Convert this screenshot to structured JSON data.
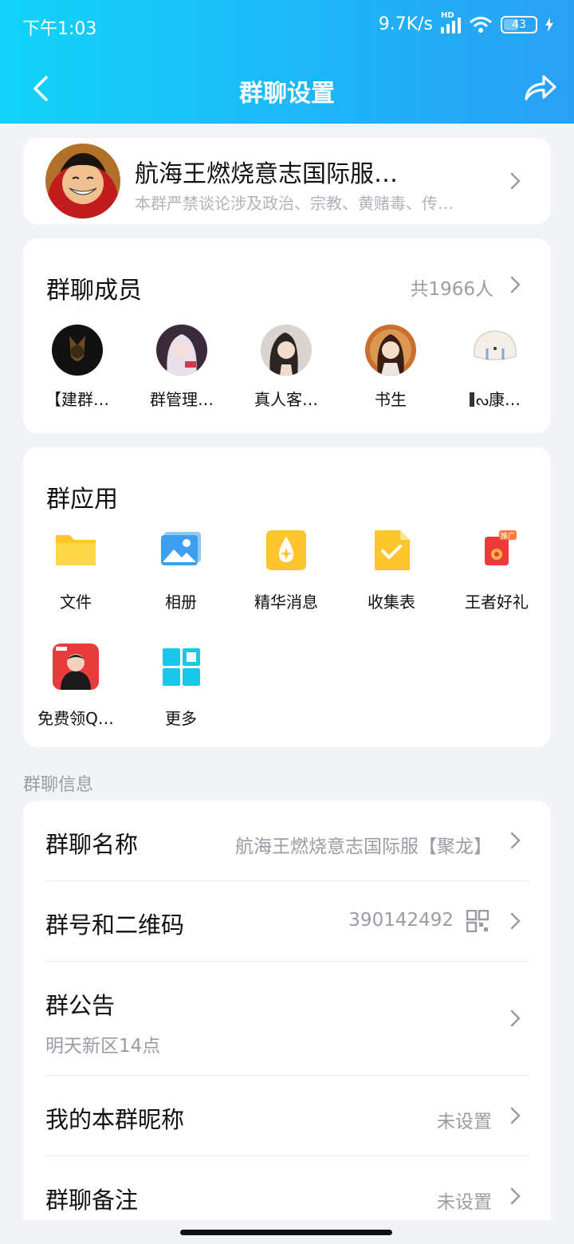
{
  "status_bar": {
    "time": "下午1:03",
    "net_speed": "9.7K/s",
    "hd": "HD",
    "battery": "43"
  },
  "nav": {
    "title": "群聊设置"
  },
  "group": {
    "name": "航海王燃烧意志国际服…",
    "description": "本群严禁谈论涉及政治、宗教、黄赌毒、传…"
  },
  "members_section": {
    "title": "群聊成员",
    "count": "共1966人",
    "members": [
      {
        "name": "【建群…"
      },
      {
        "name": "群管理…"
      },
      {
        "name": "真人客…"
      },
      {
        "name": "书生"
      },
      {
        "name": "康…"
      }
    ]
  },
  "apps_section": {
    "title": "群应用",
    "apps": [
      {
        "label": "文件",
        "icon": "folder-icon"
      },
      {
        "label": "相册",
        "icon": "album-icon"
      },
      {
        "label": "精华消息",
        "icon": "essence-icon"
      },
      {
        "label": "收集表",
        "icon": "form-icon"
      },
      {
        "label": "王者好礼",
        "icon": "gift-icon",
        "badge": "推广"
      },
      {
        "label": "免费领Q…",
        "icon": "promo-icon"
      },
      {
        "label": "更多",
        "icon": "more-grid-icon"
      }
    ]
  },
  "info_section": {
    "label": "群聊信息",
    "rows": {
      "name": {
        "label": "群聊名称",
        "value": "航海王燃烧意志国际服【聚龙】"
      },
      "number": {
        "label": "群号和二维码",
        "value": "390142492"
      },
      "notice": {
        "label": "群公告",
        "sub": "明天新区14点"
      },
      "nickname": {
        "label": "我的本群昵称",
        "value": "未设置"
      },
      "remark": {
        "label": "群聊备注",
        "value": "未设置"
      }
    }
  },
  "colors": {
    "header_start": "#12d4f8",
    "header_end": "#2aa0f5",
    "background": "#f2f3f7"
  }
}
